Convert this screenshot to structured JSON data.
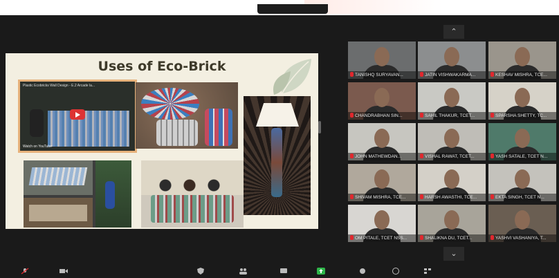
{
  "meeting": {
    "slide": {
      "title": "Uses of Eco-Brick",
      "video_title": "Plastic Ecobricks Wall Design - E.2 Arcade la...",
      "video_watch": "Watch on YouTube"
    },
    "gallery": {
      "scroll_up_icon": "chevron-up-icon",
      "scroll_down_icon": "chevron-down-icon",
      "participants": [
        {
          "name": "TANISHQ SURYAVAN...",
          "bg": "#6b6d6e"
        },
        {
          "name": "JATIN VISHWAKARMA...",
          "bg": "#8c8e8f"
        },
        {
          "name": "KESHAV MISHRA, TCE...",
          "bg": "#9a958c"
        },
        {
          "name": "CHANDRABHAN SIN...",
          "bg": "#7b5a4e"
        },
        {
          "name": "SAHIL THAKUR, TCET...",
          "bg": "#c9c9c4"
        },
        {
          "name": "SPARSHA SHETTY, TC...",
          "bg": "#d6d2c8"
        },
        {
          "name": "JOHN MATHEWDAN...",
          "bg": "#c7c6c0"
        },
        {
          "name": "VISHAL RAWAT, TCET...",
          "bg": "#bfbdb7"
        },
        {
          "name": "YASH SATALE, TCET N...",
          "bg": "#4f7a6a"
        },
        {
          "name": "SHIVAM MISHRA, TCE...",
          "bg": "#b0a89c"
        },
        {
          "name": "HARSH AWASTHI, TCE...",
          "bg": "#d4d0c8"
        },
        {
          "name": "EKTA SINGH, TCET N...",
          "bg": "#c4c2bc"
        },
        {
          "name": "OM PITALE, TCET NSS...",
          "bg": "#d8d6d2"
        },
        {
          "name": "SHALIKNA DU, TCET...",
          "bg": "#a8a49a"
        },
        {
          "name": "YASHVI VASHANIYA, T...",
          "bg": "#6a5e52"
        }
      ]
    }
  }
}
